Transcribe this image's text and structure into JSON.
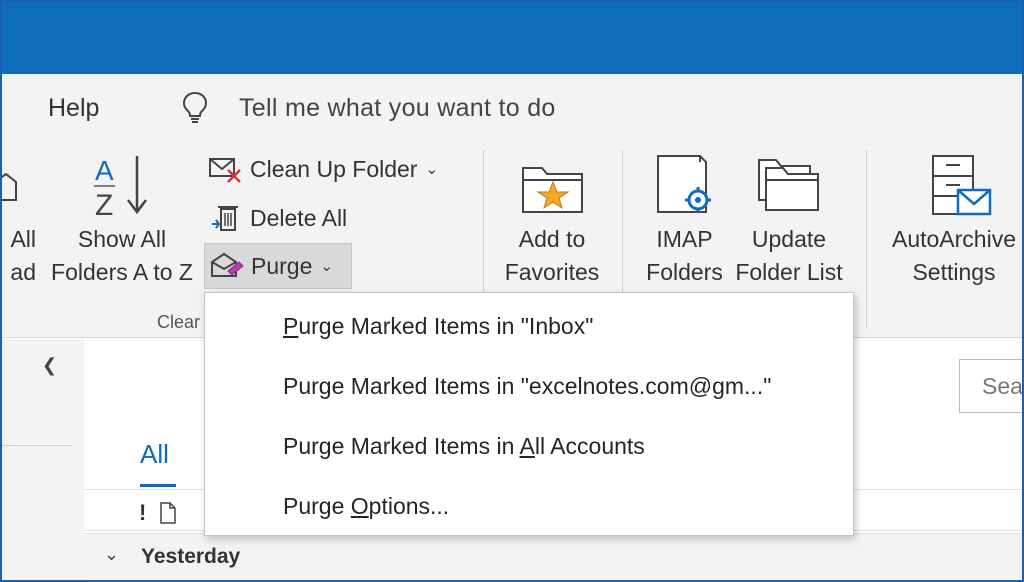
{
  "tell_me": {
    "help_label": "Help",
    "placeholder": "Tell me what you want to do",
    "bulb_icon": "lightbulb-icon"
  },
  "ribbon": {
    "partial_left": {
      "line1": "All",
      "line2": "ad"
    },
    "show_all": {
      "line1": "Show All",
      "line2": "Folders A to Z",
      "icon": "sort-az-icon"
    },
    "clean_up": {
      "label": "Clean Up Folder",
      "icon": "clean-up-icon"
    },
    "delete_all": {
      "label": "Delete All",
      "icon": "delete-all-icon"
    },
    "purge": {
      "label": "Purge",
      "icon": "purge-icon"
    },
    "group_clean_label": "Clear",
    "add_favorites": {
      "line1": "Add to",
      "line2": "Favorites",
      "icon": "folder-star-icon"
    },
    "imap": {
      "line1": "IMAP",
      "line2": "Folders",
      "icon": "imap-folders-icon"
    },
    "update_list": {
      "line1": "Update",
      "line2": "Folder List",
      "icon": "folders-icon"
    },
    "autoarchive": {
      "line1": "AutoArchive",
      "line2": "Settings",
      "icon": "autoarchive-icon"
    }
  },
  "dropdown": {
    "items": [
      {
        "pre": "",
        "key": "P",
        "post": "urge Marked Items in \"Inbox\""
      },
      {
        "pre": "Pur",
        "key": "g",
        "post": "e Marked Items in \"excelnotes.com@gm...\""
      },
      {
        "pre": "Purge Marked Items in ",
        "key": "A",
        "post": "ll Accounts"
      },
      {
        "pre": "Purge ",
        "key": "O",
        "post": "ptions..."
      }
    ]
  },
  "message_list": {
    "tab_all": "All",
    "search_placeholder": "Sea",
    "group_header": "Yesterday",
    "importance_symbol": "!"
  },
  "colors": {
    "titlebar": "#0f6cbd",
    "accent": "#0f6cbd",
    "ribbon_bg": "#f3f3f3"
  }
}
